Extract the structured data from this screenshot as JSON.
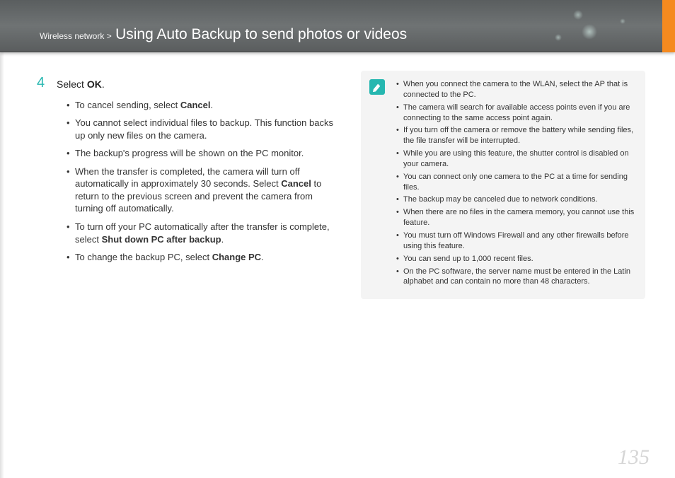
{
  "header": {
    "breadcrumb_section": "Wireless network",
    "breadcrumb_sep": ">",
    "breadcrumb_title": "Using Auto Backup to send photos or videos"
  },
  "step": {
    "number": "4",
    "text_prefix": "Select ",
    "text_bold": "OK",
    "text_suffix": "."
  },
  "bullets": [
    {
      "pre": "To cancel sending, select ",
      "b1": "Cancel",
      "mid": ".",
      "b2": "",
      "post": ""
    },
    {
      "pre": "You cannot select individual files to backup. This function backs up only new files on the camera.",
      "b1": "",
      "mid": "",
      "b2": "",
      "post": ""
    },
    {
      "pre": "The backup's progress will be shown on the PC monitor.",
      "b1": "",
      "mid": "",
      "b2": "",
      "post": ""
    },
    {
      "pre": "When the transfer is completed, the camera will turn off automatically in approximately 30 seconds. Select ",
      "b1": "Cancel",
      "mid": " to return to the previous screen and prevent the camera from turning off automatically.",
      "b2": "",
      "post": ""
    },
    {
      "pre": "To turn off your PC automatically after the transfer is complete, select ",
      "b1": "Shut down PC after backup",
      "mid": ".",
      "b2": "",
      "post": ""
    },
    {
      "pre": "To change the backup PC, select ",
      "b1": "Change PC",
      "mid": ".",
      "b2": "",
      "post": ""
    }
  ],
  "notes": [
    "When you connect the camera to the WLAN, select the AP that is connected to the PC.",
    "The camera will search for available access points even if you are connecting to the same access point again.",
    "If you turn off the camera or remove the battery while sending files, the file transfer will be interrupted.",
    "While you are using this feature, the shutter control is disabled on your camera.",
    "You can connect only one camera to the PC at a time for sending files.",
    "The backup may be canceled due to network conditions.",
    "When there are no files in the camera memory, you cannot use this feature.",
    "You must turn off Windows Firewall and any other firewalls before using this feature.",
    "You can send up to 1,000 recent files.",
    "On the PC software, the server name must be entered in the Latin alphabet and can contain no more than 48 characters."
  ],
  "page_number": "135"
}
